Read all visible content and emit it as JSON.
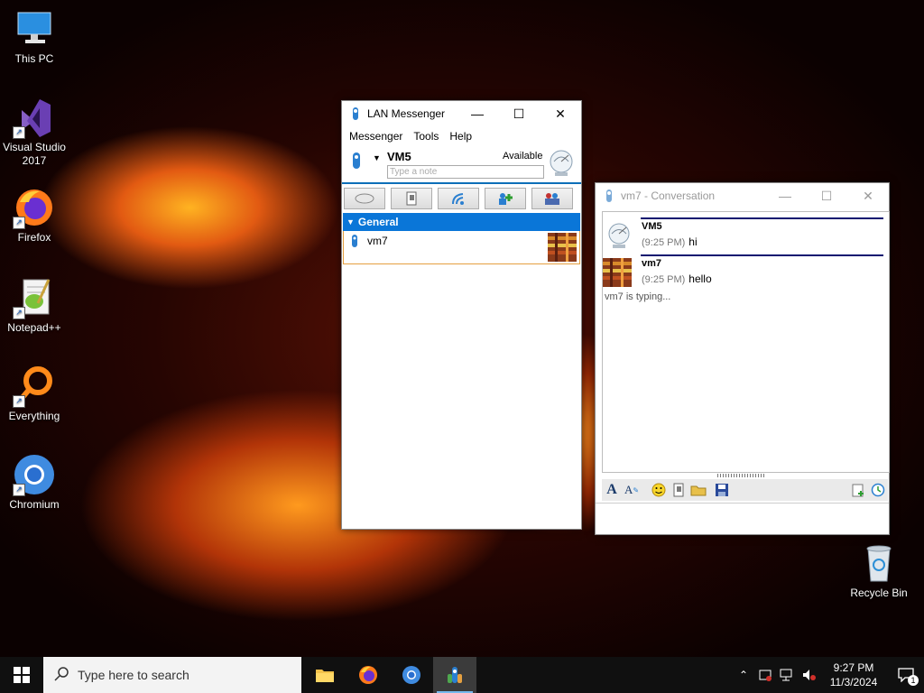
{
  "desktop": {
    "icons": [
      {
        "label": "This PC"
      },
      {
        "label": "Visual Studio 2017"
      },
      {
        "label": "Firefox"
      },
      {
        "label": "Notepad++"
      },
      {
        "label": "Everything"
      },
      {
        "label": "Chromium"
      },
      {
        "label": "Recycle Bin"
      }
    ]
  },
  "messenger": {
    "title": "LAN Messenger",
    "menu": [
      "Messenger",
      "Tools",
      "Help"
    ],
    "user_name": "VM5",
    "status": "Available",
    "note_placeholder": "Type a note",
    "group_name": "General",
    "contacts": [
      {
        "name": "vm7"
      }
    ]
  },
  "conversation": {
    "title": "vm7 - Conversation",
    "messages": [
      {
        "sender": "VM5",
        "time": "(9:25 PM)",
        "text": "hi"
      },
      {
        "sender": "vm7",
        "time": "(9:25 PM)",
        "text": "hello"
      }
    ],
    "typing_status": "vm7 is typing..."
  },
  "taskbar": {
    "search_placeholder": "Type here to search",
    "time": "9:27 PM",
    "date": "11/3/2024",
    "notification_count": "1"
  },
  "colors": {
    "accent": "#0a76d8",
    "message_rule": "#0b1470",
    "taskbar": "#101010"
  }
}
